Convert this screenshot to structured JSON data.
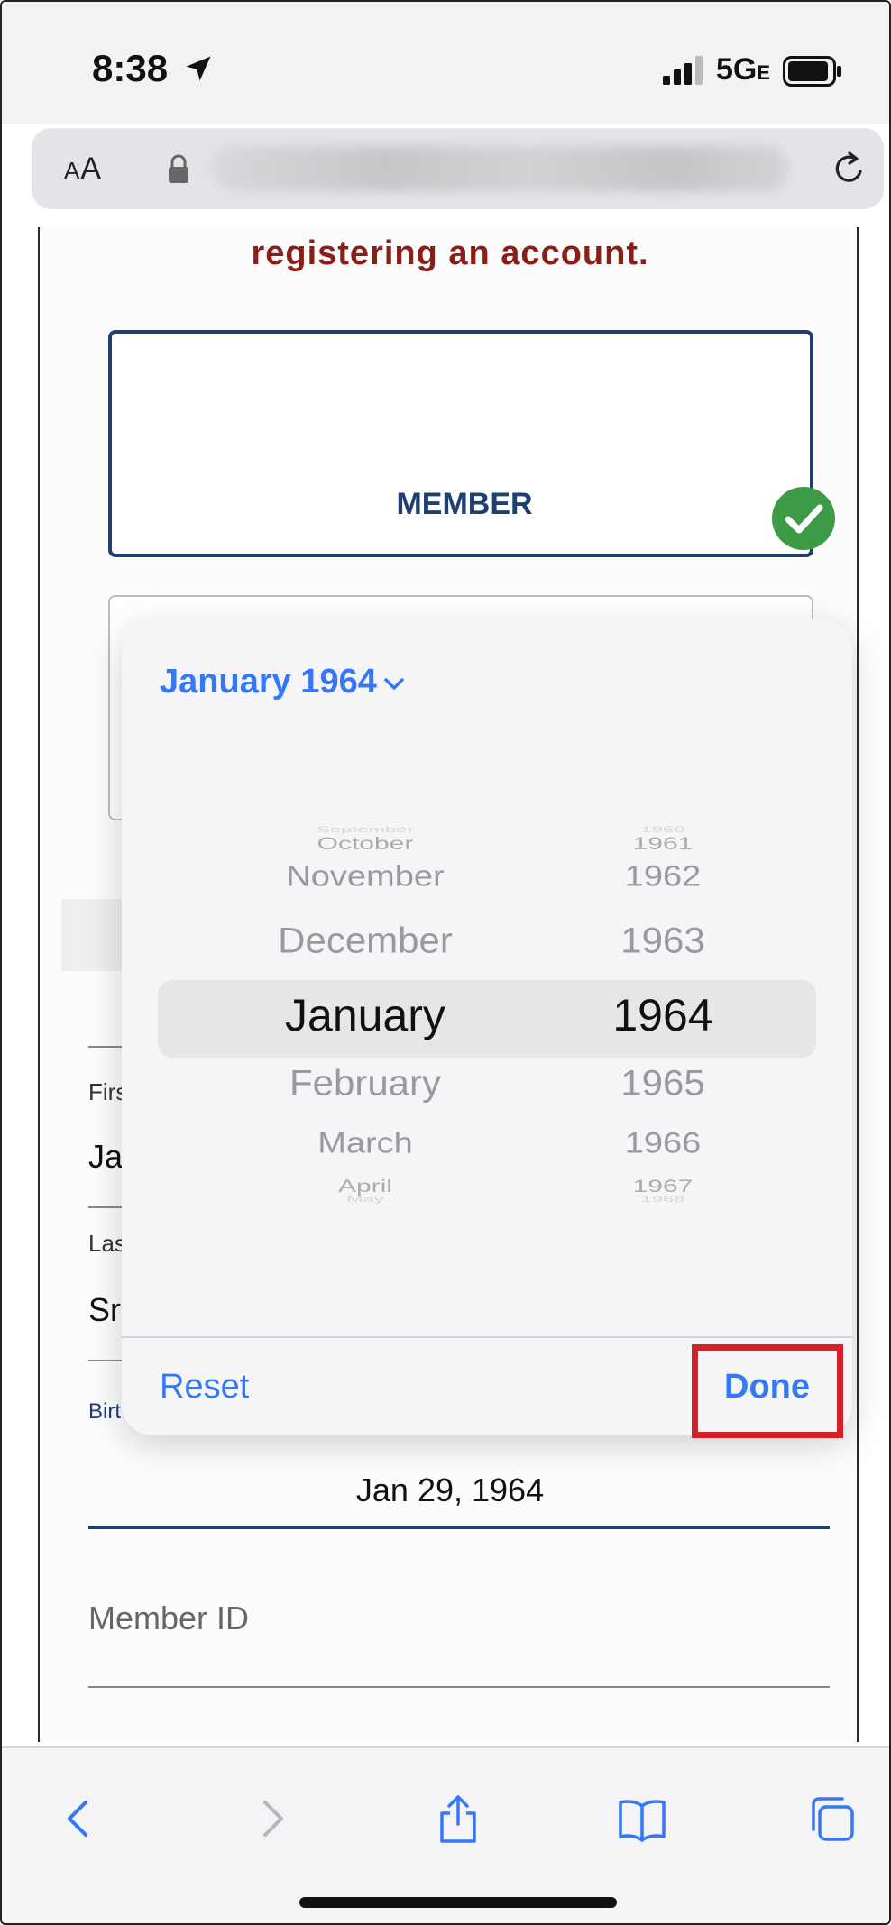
{
  "status": {
    "time": "8:38",
    "network": "5G",
    "network_suffix": "E"
  },
  "address_bar": {
    "text_size_label_small": "A",
    "text_size_label_large": "A"
  },
  "page": {
    "warning": "registering an account.",
    "member_card_label": "MEMBER",
    "first_name_label": "Firs",
    "first_name_value": "Ja",
    "last_name_label": "Las",
    "last_name_value": "Sr",
    "birth_label": "Birt",
    "birthdate_value": "Jan 29, 1964",
    "member_id_placeholder": "Member ID"
  },
  "picker": {
    "header": "January 1964",
    "months": [
      "September",
      "October",
      "November",
      "December",
      "January",
      "February",
      "March",
      "April",
      "May"
    ],
    "years": [
      "1960",
      "1961",
      "1962",
      "1963",
      "1964",
      "1965",
      "1966",
      "1967",
      "1968"
    ],
    "selected_month": "January",
    "selected_year": "1964",
    "reset_label": "Reset",
    "done_label": "Done"
  },
  "colors": {
    "accent": "#3478f6",
    "brand_navy": "#1f3f73",
    "warning": "#8b1e16",
    "highlight": "#d42027",
    "check": "#3d9b47"
  },
  "icons": [
    "location-arrow-icon",
    "signal-icon",
    "battery-icon",
    "lock-icon",
    "reload-icon",
    "chevron-down-icon",
    "checkmark-icon",
    "back-icon",
    "forward-icon",
    "share-icon",
    "bookmarks-icon",
    "tabs-icon"
  ]
}
